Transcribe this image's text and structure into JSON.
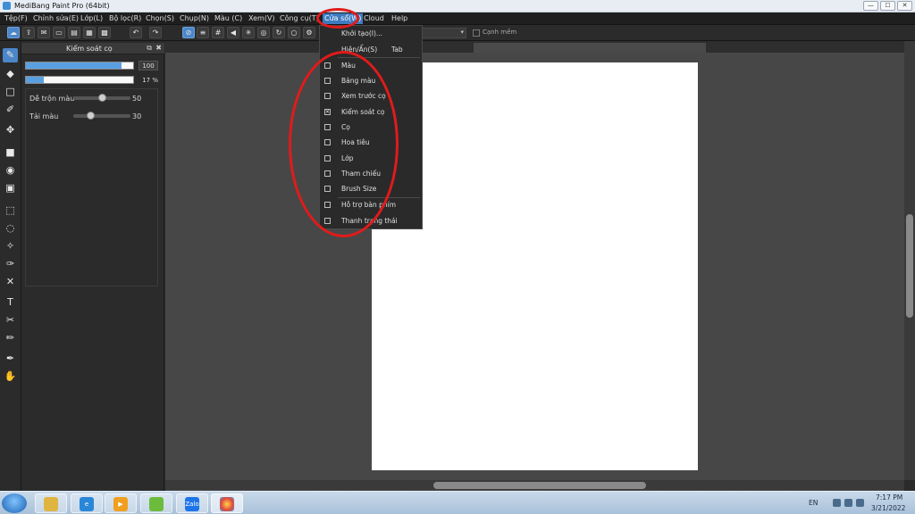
{
  "window": {
    "title": "MediBang Paint Pro (64bit)",
    "minimize": "—",
    "maximize": "☐",
    "close": "✕"
  },
  "menu": {
    "items": [
      "Tệp(F)",
      "Chỉnh sửa(E)",
      "Lớp(L)",
      "Bộ lọc(R)",
      "Chọn(S)",
      "Chụp(N)",
      "Màu (C)",
      "Xem(V)",
      "Công cụ(T)",
      "Cửa sổ(W)",
      "Cloud",
      "Help"
    ],
    "active": "Cửa sổ(W)"
  },
  "toolbar": {
    "checkbox_label": "Cạnh mềm"
  },
  "brush_panel": {
    "title": "Kiểm soát cọ",
    "size_value": "100",
    "size_fraction": 0.89,
    "opacity_value": "17 %",
    "opacity_fraction": 0.17,
    "sliders": [
      {
        "label": "Dễ trộn màu",
        "value": "50",
        "fraction": 0.5
      },
      {
        "label": "Tải màu",
        "value": "30",
        "fraction": 0.3
      }
    ]
  },
  "window_menu": {
    "items": [
      {
        "label": "Khởi tạo(I)...",
        "shortcut": "",
        "check": "none"
      },
      {
        "label": "Hiện/Ẩn(S)",
        "shortcut": "Tab",
        "check": "none"
      },
      {
        "label": "Màu",
        "shortcut": "",
        "check": "unchecked"
      },
      {
        "label": "Bảng màu",
        "shortcut": "",
        "check": "unchecked"
      },
      {
        "label": "Xem trước cọ",
        "shortcut": "",
        "check": "unchecked"
      },
      {
        "label": "Kiểm soát cọ",
        "shortcut": "",
        "check": "checked"
      },
      {
        "label": "Cọ",
        "shortcut": "",
        "check": "unchecked"
      },
      {
        "label": "Hoa tiêu",
        "shortcut": "",
        "check": "unchecked"
      },
      {
        "label": "Lớp",
        "shortcut": "",
        "check": "unchecked"
      },
      {
        "label": "Tham chiếu",
        "shortcut": "",
        "check": "unchecked"
      },
      {
        "label": "Brush Size",
        "shortcut": "",
        "check": "unchecked"
      },
      {
        "label": "Hỗ trợ bàn phím",
        "shortcut": "",
        "check": "unchecked"
      },
      {
        "label": "Thanh trạng thái",
        "shortcut": "",
        "check": "unchecked"
      }
    ]
  },
  "taskbar": {
    "zalo_label": "Zalo",
    "language": "EN",
    "time": "7:17 PM",
    "date": "3/21/2022"
  },
  "colors": {
    "accent": "#3e7bc1",
    "annotation": "#e01b1b",
    "canvas": "#ffffff",
    "workspace": "#474747"
  }
}
